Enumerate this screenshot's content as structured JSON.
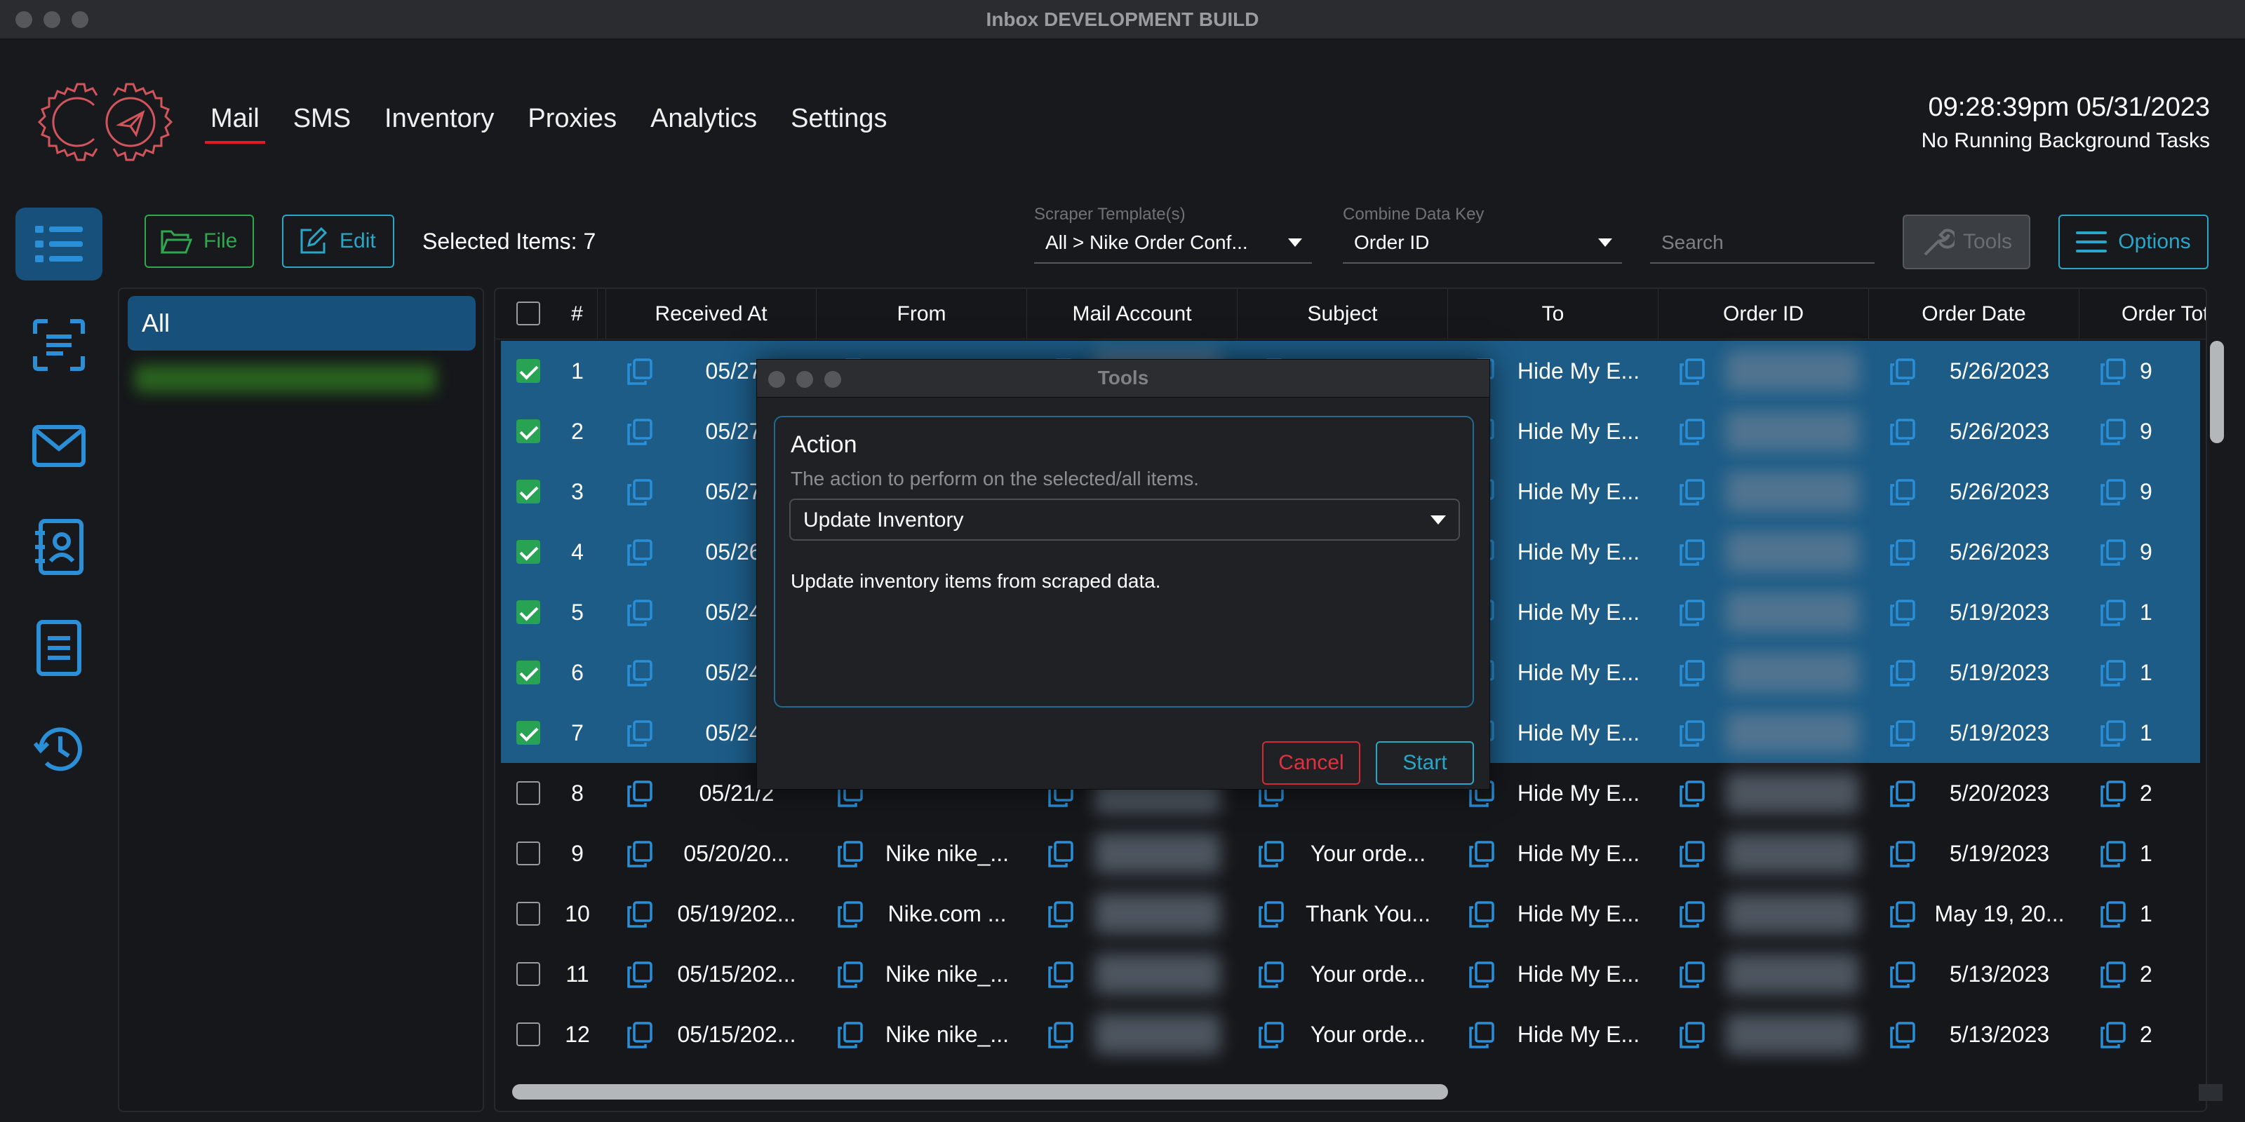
{
  "window": {
    "title": "Inbox DEVELOPMENT BUILD"
  },
  "nav": {
    "items": [
      "Mail",
      "SMS",
      "Inventory",
      "Proxies",
      "Analytics",
      "Settings"
    ],
    "active": "Mail"
  },
  "header": {
    "clock": "09:28:39pm 05/31/2023",
    "background_tasks": "No Running Background Tasks"
  },
  "sidebar_icons": [
    "list-icon",
    "scan-icon",
    "mail-icon",
    "contacts-icon",
    "document-icon",
    "history-icon"
  ],
  "toolbar": {
    "file_label": "File",
    "edit_label": "Edit",
    "selected_items": "Selected Items: 7",
    "scraper_label": "Scraper Template(s)",
    "scraper_value": "All > Nike Order Conf...",
    "combine_label": "Combine Data Key",
    "combine_value": "Order ID",
    "search_placeholder": "Search",
    "tools_label": "Tools",
    "options_label": "Options"
  },
  "folders": {
    "all_label": "All"
  },
  "table": {
    "columns": [
      "#",
      "Received At",
      "From",
      "Mail Account",
      "Subject",
      "To",
      "Order ID",
      "Order Date",
      "Order Tota"
    ],
    "rows": [
      {
        "num": "1",
        "received": "05/27/",
        "from": "",
        "subject": "",
        "to": "Hide My E...",
        "date": "5/26/2023",
        "total": "9",
        "selected": true
      },
      {
        "num": "2",
        "received": "05/27/",
        "from": "",
        "subject": "",
        "to": "Hide My E...",
        "date": "5/26/2023",
        "total": "9",
        "selected": true
      },
      {
        "num": "3",
        "received": "05/27/",
        "from": "",
        "subject": "",
        "to": "Hide My E...",
        "date": "5/26/2023",
        "total": "9",
        "selected": true
      },
      {
        "num": "4",
        "received": "05/26/",
        "from": "",
        "subject": "",
        "to": "Hide My E...",
        "date": "5/26/2023",
        "total": "9",
        "selected": true
      },
      {
        "num": "5",
        "received": "05/24/",
        "from": "",
        "subject": "",
        "to": "Hide My E...",
        "date": "5/19/2023",
        "total": "1",
        "selected": true
      },
      {
        "num": "6",
        "received": "05/24/",
        "from": "",
        "subject": "",
        "to": "Hide My E...",
        "date": "5/19/2023",
        "total": "1",
        "selected": true
      },
      {
        "num": "7",
        "received": "05/24/",
        "from": "",
        "subject": "",
        "to": "Hide My E...",
        "date": "5/19/2023",
        "total": "1",
        "selected": true
      },
      {
        "num": "8",
        "received": "05/21/2",
        "from": "",
        "subject": "",
        "to": "Hide My E...",
        "date": "5/20/2023",
        "total": "2",
        "selected": false
      },
      {
        "num": "9",
        "received": "05/20/20...",
        "from": "Nike nike_...",
        "subject": "Your orde...",
        "to": "Hide My E...",
        "date": "5/19/2023",
        "total": "1",
        "selected": false
      },
      {
        "num": "10",
        "received": "05/19/202...",
        "from": "Nike.com ...",
        "subject": "Thank You...",
        "to": "Hide My E...",
        "date": "May 19, 20...",
        "total": "1",
        "selected": false
      },
      {
        "num": "11",
        "received": "05/15/202...",
        "from": "Nike nike_...",
        "subject": "Your orde...",
        "to": "Hide My E...",
        "date": "5/13/2023",
        "total": "2",
        "selected": false
      },
      {
        "num": "12",
        "received": "05/15/202...",
        "from": "Nike nike_...",
        "subject": "Your orde...",
        "to": "Hide My E...",
        "date": "5/13/2023",
        "total": "2",
        "selected": false
      }
    ]
  },
  "dialog": {
    "title": "Tools",
    "action_heading": "Action",
    "action_description": "The action to perform on the selected/all items.",
    "action_value": "Update Inventory",
    "info": "Update inventory items from scraped data.",
    "cancel_label": "Cancel",
    "start_label": "Start"
  },
  "colors": {
    "accent": "#2aa6c8",
    "selection": "#1d5c87",
    "danger": "#e0323e",
    "success": "#2fa84f"
  }
}
